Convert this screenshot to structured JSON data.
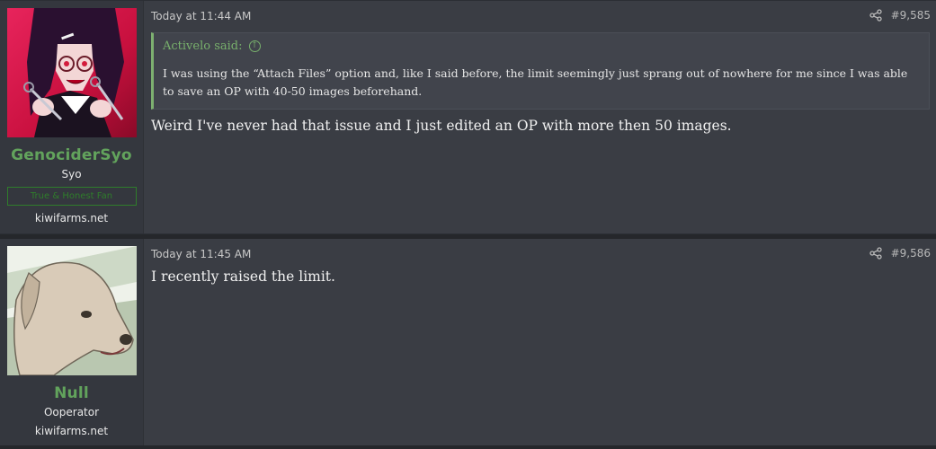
{
  "posts": [
    {
      "user": {
        "name": "GenociderSyo",
        "title": "Syo",
        "banner": "True & Honest Fan",
        "site": "kiwifarms.net",
        "avatar": "anime-girl-scissors-avatar"
      },
      "date": "Today at 11:44 AM",
      "number": "#9,585",
      "quote": {
        "author": "Activelo said:",
        "text": "I was using the “Attach Files” option and, like I said before, the limit seemingly just sprang out of nowhere for me since I was able to save an OP with 40-50 images beforehand."
      },
      "body": "Weird I've never had that issue and I just edited an OP with more then 50 images."
    },
    {
      "user": {
        "name": "Null",
        "title": "Ooperator",
        "site": "kiwifarms.net",
        "avatar": "dog-avatar"
      },
      "date": "Today at 11:45 AM",
      "number": "#9,586",
      "body": "I recently raised the limit."
    }
  ],
  "colors": {
    "username": "#62a35c",
    "quote_accent": "#78b06c",
    "banner": "#2f7d2b",
    "post_bg": "#3a3d44"
  }
}
